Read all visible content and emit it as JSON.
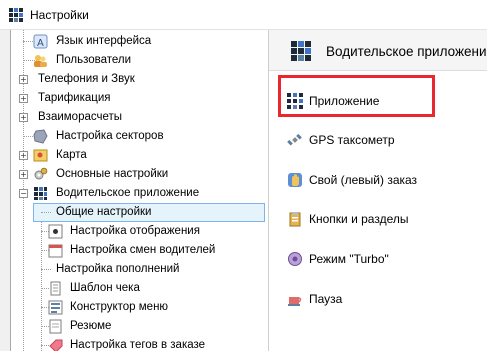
{
  "window": {
    "title": "Настройки"
  },
  "tree": {
    "items": [
      {
        "label": "Язык интерфейса",
        "icon": "font-icon"
      },
      {
        "label": "Пользователи",
        "icon": "users-icon"
      },
      {
        "label": "Телефония и Звук",
        "icon": "phone-icon"
      },
      {
        "label": "Тарификация",
        "icon": "tariff-icon"
      },
      {
        "label": "Взаиморасчеты",
        "icon": "settlements-icon"
      },
      {
        "label": "Настройка секторов",
        "icon": "sector-icon"
      },
      {
        "label": "Карта",
        "icon": "map-icon"
      },
      {
        "label": "Основные настройки",
        "icon": "gears-icon"
      },
      {
        "label": "Водительское приложение",
        "icon": "app-grid-icon"
      },
      {
        "label": "Общие настройки",
        "icon": "none"
      },
      {
        "label": "Настройка отображения",
        "icon": "display-icon"
      },
      {
        "label": "Настройка смен водителей",
        "icon": "shift-icon"
      },
      {
        "label": "Настройка пополнений",
        "icon": "none"
      },
      {
        "label": "Шаблон чека",
        "icon": "receipt-icon"
      },
      {
        "label": "Конструктор меню",
        "icon": "menu-icon"
      },
      {
        "label": "Резюме",
        "icon": "resume-icon"
      },
      {
        "label": "Настройка тегов в заказе",
        "icon": "tag-icon"
      }
    ]
  },
  "panel": {
    "header_title": "Водительское приложение",
    "items": [
      {
        "label": "Приложение",
        "icon": "app-grid-icon"
      },
      {
        "label": "GPS таксометр",
        "icon": "satellite-icon"
      },
      {
        "label": "Свой (левый) заказ",
        "icon": "hand-icon"
      },
      {
        "label": "Кнопки и разделы",
        "icon": "clipboard-icon"
      },
      {
        "label": "Режим \"Turbo\"",
        "icon": "turbo-icon"
      },
      {
        "label": "Пауза",
        "icon": "coffee-icon"
      }
    ]
  },
  "colors": {
    "highlight": "#e8282e",
    "selection": "#e5f3fb",
    "selection_border": "#7eb4ea"
  }
}
